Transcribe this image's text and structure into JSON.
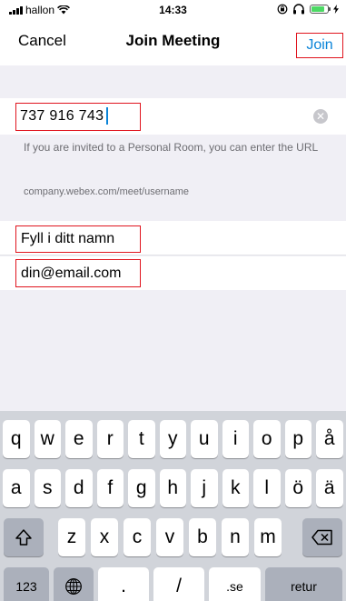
{
  "status": {
    "carrier": "hallon",
    "time": "14:33",
    "battery_level": 0.8
  },
  "nav": {
    "cancel": "Cancel",
    "title": "Join Meeting",
    "join": "Join"
  },
  "meeting": {
    "value": "737 916 743",
    "hint": "If you are invited to a Personal Room, you can enter the URL",
    "url_example": "company.webex.com/meet/username"
  },
  "form": {
    "name_placeholder": "Fyll i ditt namn",
    "email_placeholder": "din@email.com"
  },
  "keyboard": {
    "row1": [
      "q",
      "w",
      "e",
      "r",
      "t",
      "y",
      "u",
      "i",
      "o",
      "p",
      "å"
    ],
    "row2": [
      "a",
      "s",
      "d",
      "f",
      "g",
      "h",
      "j",
      "k",
      "l",
      "ö",
      "ä"
    ],
    "row3": [
      "z",
      "x",
      "c",
      "v",
      "b",
      "n",
      "m"
    ],
    "numbers": "123",
    "period": ".",
    "slash": "/",
    "domain": ".se",
    "return": "retur"
  },
  "colors": {
    "link": "#0a84d8",
    "highlight": "#e0141e",
    "battery": "#4cd964"
  }
}
